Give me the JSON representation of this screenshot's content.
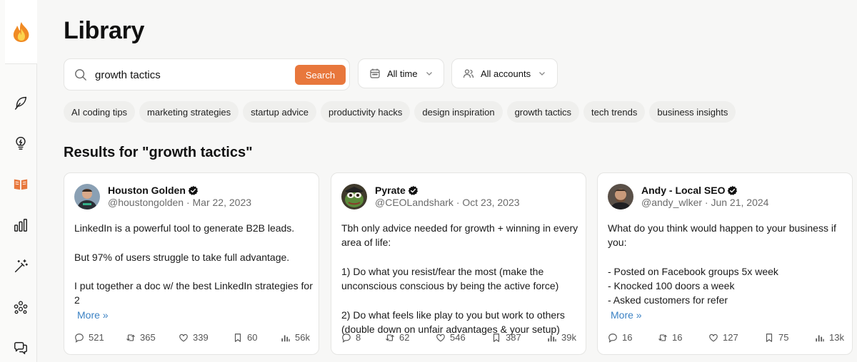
{
  "page": {
    "title": "Library"
  },
  "search": {
    "value": "growth tactics",
    "placeholder": "",
    "button_label": "Search"
  },
  "filters": {
    "time": "All time",
    "accounts": "All accounts"
  },
  "chips": [
    "AI coding tips",
    "marketing strategies",
    "startup advice",
    "productivity hacks",
    "design inspiration",
    "growth tactics",
    "tech trends",
    "business insights"
  ],
  "results": {
    "title": "Results for \"growth tactics\""
  },
  "colors": {
    "accent": "#e8773c",
    "link": "#3b82c4",
    "verified": "#111111"
  },
  "sidebar": {
    "icons": [
      "fire-logo",
      "feather-icon",
      "lightbulb-icon",
      "book-icon",
      "bar-chart-icon",
      "magic-wand-icon",
      "people-icon",
      "chat-icon"
    ],
    "active": "book-icon"
  },
  "posts": [
    {
      "name": "Houston Golden",
      "meta": "@houstongolden · Mar 22, 2023",
      "text": "LinkedIn is a powerful tool to generate B2B leads.\n\nBut 97% of users struggle to take full advantage.\n\nI put together a doc w/ the best LinkedIn strategies for 2",
      "more": "More »",
      "stats": {
        "replies": "521",
        "retweets": "365",
        "likes": "339",
        "bookmarks": "60",
        "views": "56k"
      }
    },
    {
      "name": "Pyrate",
      "meta": "@CEOLandshark · Oct 23, 2023",
      "text": "Tbh only advice needed for growth + winning in every area of life:\n\n1) Do what you resist/fear the most (make the unconscious conscious by being the active force)\n\n2) Do what feels like play to you but work to others (double down on unfair advantages & your setup)",
      "more": "",
      "stats": {
        "replies": "8",
        "retweets": "62",
        "likes": "546",
        "bookmarks": "387",
        "views": "39k"
      }
    },
    {
      "name": "Andy - Local SEO",
      "meta": "@andy_wlker · Jun 21, 2024",
      "text": "What do you think would happen to your business if you:\n\n- Posted on Facebook groups 5x week\n- Knocked 100 doors a week\n- Asked customers for refer",
      "more": "More »",
      "stats": {
        "replies": "16",
        "retweets": "16",
        "likes": "127",
        "bookmarks": "75",
        "views": "13k"
      }
    }
  ]
}
